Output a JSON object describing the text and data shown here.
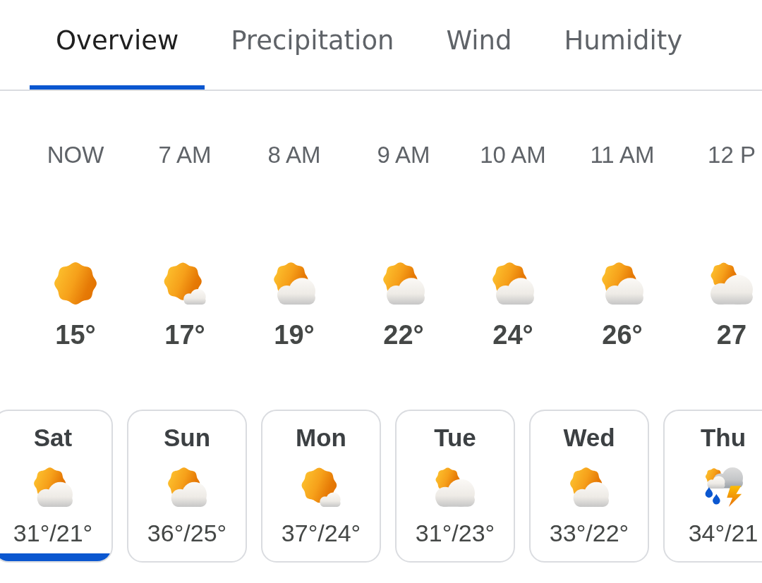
{
  "tabs": [
    {
      "label": "Overview",
      "selected": true
    },
    {
      "label": "Precipitation",
      "selected": false
    },
    {
      "label": "Wind",
      "selected": false
    },
    {
      "label": "Humidity",
      "selected": false
    }
  ],
  "hourly": [
    {
      "time": "NOW",
      "kind": "sunny",
      "temp": "15°"
    },
    {
      "time": "7 AM",
      "kind": "mostlysunny",
      "temp": "17°"
    },
    {
      "time": "8 AM",
      "kind": "partlycloudy",
      "temp": "19°"
    },
    {
      "time": "9 AM",
      "kind": "partlycloudy",
      "temp": "22°"
    },
    {
      "time": "10 AM",
      "kind": "partlycloudy",
      "temp": "24°"
    },
    {
      "time": "11 AM",
      "kind": "partlycloudy",
      "temp": "26°"
    },
    {
      "time": "12 P",
      "kind": "mostlycloudy",
      "temp": "27"
    }
  ],
  "days": [
    {
      "day": "Sat",
      "kind": "partlycloudy",
      "temps": "31°/21°",
      "selected": true
    },
    {
      "day": "Sun",
      "kind": "partlycloudy",
      "temps": "36°/25°",
      "selected": false
    },
    {
      "day": "Mon",
      "kind": "mostlysunny",
      "temps": "37°/24°",
      "selected": false
    },
    {
      "day": "Tue",
      "kind": "mostlycloudy",
      "temps": "31°/23°",
      "selected": false
    },
    {
      "day": "Wed",
      "kind": "partlycloudy",
      "temps": "33°/22°",
      "selected": false
    },
    {
      "day": "Thu",
      "kind": "thunderstorm",
      "temps": "34°/21",
      "selected": false
    }
  ]
}
